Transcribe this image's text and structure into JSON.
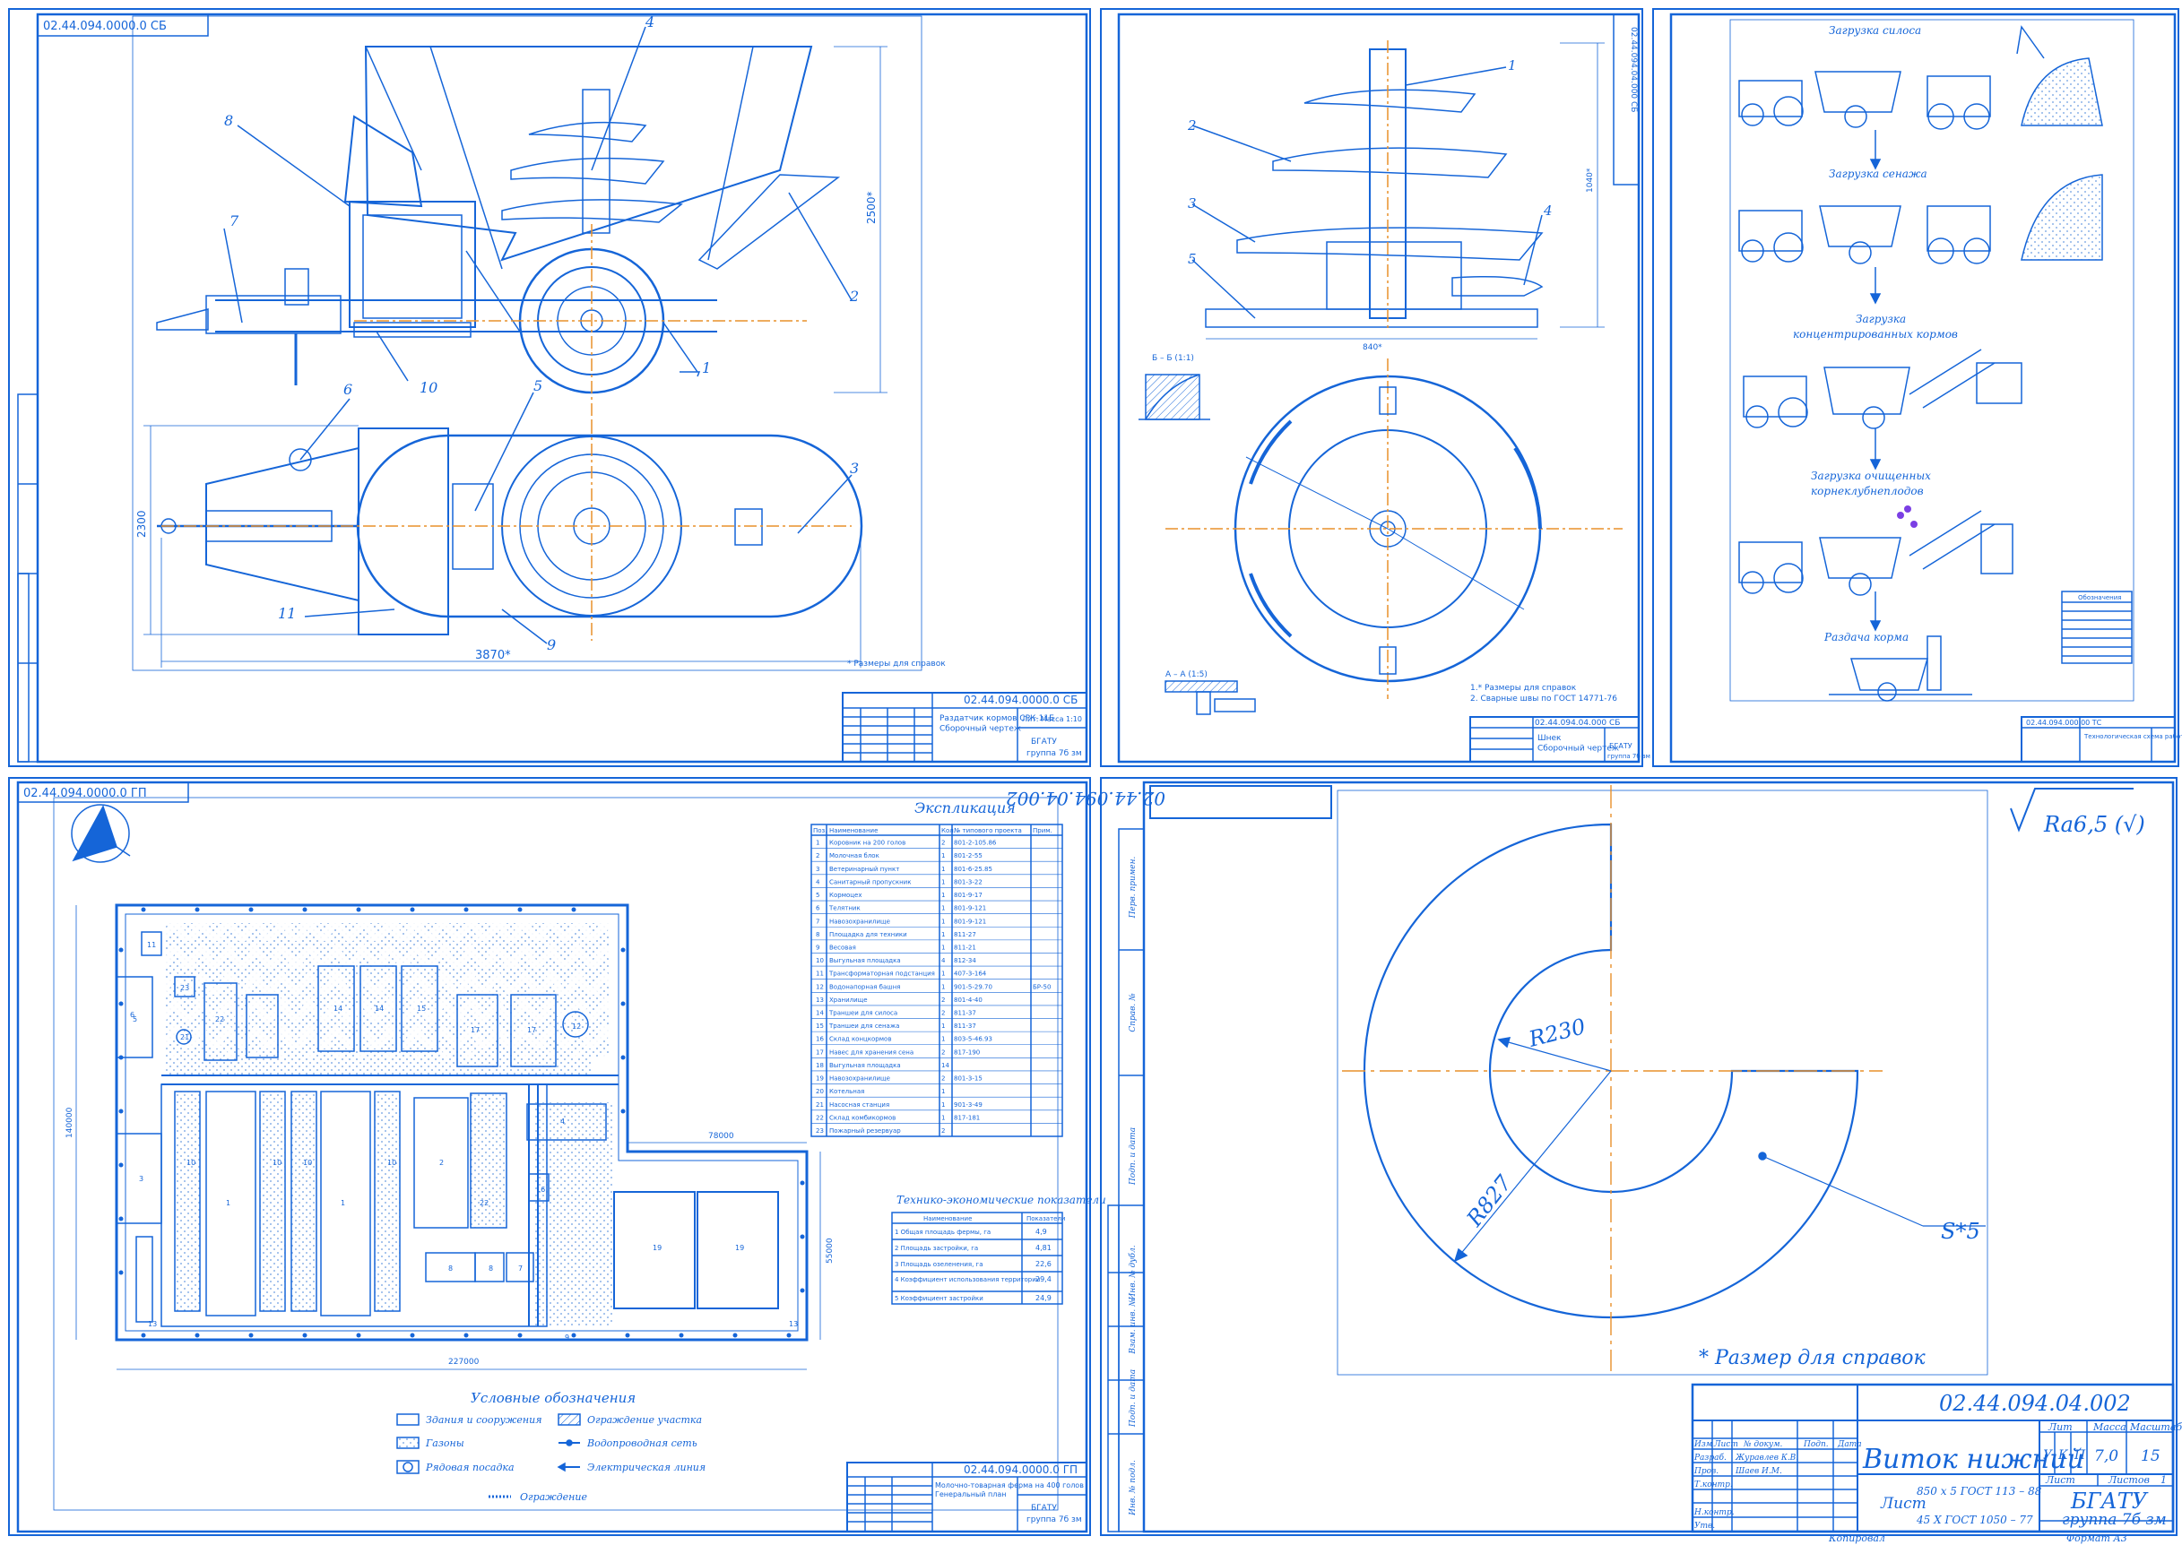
{
  "sheets": {
    "combine": {
      "code_stamp": "02.44.094.0000.0 СБ",
      "code_rot": "02.44.094.0000.0 СБ",
      "title": "Раздатчик кормов СРК-11Б\nСборочный чертеж",
      "sheet_info": "Лит. Масса 1:10",
      "org": "БГАТУ",
      "group": "группа 7б зм",
      "dim_height": "2500*",
      "dim_width": "2300",
      "dim_length": "3870*",
      "note": "* Размеры для справок",
      "callouts": [
        "1",
        "2",
        "3",
        "4",
        "5",
        "6",
        "7",
        "8",
        "9",
        "10",
        "11"
      ]
    },
    "auger": {
      "code_rot": "02.44.094.04.000 СБ",
      "code_stamp": "02.44.094.04.000 СБ",
      "title": "Шнек\nСборочный чертеж",
      "org": "БГАТУ",
      "group": "группа 7б зм",
      "section_label": "Б – Б (1:1)",
      "view_label": "А – А (1:5)",
      "dim_side": "840*",
      "dim_height": "1040*",
      "note1": "1.* Размеры для справок",
      "note2": "2. Сварные швы по ГОСТ 14771-76",
      "callouts": [
        "1",
        "2",
        "3",
        "4",
        "5"
      ]
    },
    "tech": {
      "code_stamp": "02.44.094.000.00 ТС",
      "title": "Технологическая схема работы",
      "step1": "Загрузка силоса",
      "step2": "Загрузка сенажа",
      "step3": "Загрузка",
      "step3b": "концентрированных кормов",
      "step4": "Загрузка очищенных",
      "step4b": "корнеклубнеплодов",
      "step5": "Раздача корма",
      "legend_title": "Обозначения"
    },
    "plan": {
      "code_rot": "02.44.094.0000.0 ГП",
      "code_stamp": "02.44.094.0000.0 ГП",
      "title": "Молочно-товарная ферма на 400 голов\nГенеральный план",
      "org": "БГАТУ",
      "group": "группа 7б зм",
      "explication_title": "Экспликация",
      "explication_headers": [
        "Поз.",
        "Наименование",
        "Кол.",
        "№ типового проекта",
        "Прим."
      ],
      "explication_rows": [
        [
          "1",
          "Коровник на 200 голов",
          "2",
          "801-2-105.86",
          ""
        ],
        [
          "2",
          "Молочная блок",
          "1",
          "801-2-55",
          ""
        ],
        [
          "3",
          "Ветеринарный пункт",
          "1",
          "801-6-25.85",
          ""
        ],
        [
          "4",
          "Санитарный пропускник",
          "1",
          "801-3-22",
          ""
        ],
        [
          "5",
          "Кормоцех",
          "1",
          "801-9-17",
          ""
        ],
        [
          "6",
          "Телятник",
          "1",
          "801-9-121",
          ""
        ],
        [
          "7",
          "Навозохранилище",
          "1",
          "801-9-121",
          ""
        ],
        [
          "8",
          "Площадка для техники",
          "1",
          "811-27",
          ""
        ],
        [
          "9",
          "Весовая",
          "1",
          "811-21",
          ""
        ],
        [
          "10",
          "Выгульная площадка",
          "4",
          "812-34",
          ""
        ],
        [
          "11",
          "Трансформаторная подстанция",
          "1",
          "407-3-164",
          ""
        ],
        [
          "12",
          "Водонапорная башня",
          "1",
          "901-5-29.70",
          "БР-50"
        ],
        [
          "13",
          "Хранилище",
          "2",
          "801-4-40",
          ""
        ],
        [
          "14",
          "Траншеи для силоса",
          "2",
          "811-37",
          ""
        ],
        [
          "15",
          "Траншеи для сенажа",
          "1",
          "811-37",
          ""
        ],
        [
          "16",
          "Склад концкормов",
          "1",
          "803-5-46.93",
          ""
        ],
        [
          "17",
          "Навес для хранения сена",
          "2",
          "817-190",
          ""
        ],
        [
          "18",
          "Выгульная площадка",
          "14",
          "",
          ""
        ],
        [
          "19",
          "Навозохранилище",
          "2",
          "801-3-15",
          ""
        ],
        [
          "20",
          "Котельная",
          "1",
          "",
          ""
        ],
        [
          "21",
          "Насосная станция",
          "1",
          "901-3-49",
          ""
        ],
        [
          "22",
          "Склад комбикормов",
          "1",
          "817-181",
          ""
        ],
        [
          "23",
          "Пожарный резервуар",
          "2",
          "",
          ""
        ]
      ],
      "tep_title": "Технико-экономические показатели",
      "tep_headers": [
        "Наименование",
        "Показатели"
      ],
      "tep_rows": [
        [
          "1 Общая площадь фермы, га",
          "4,9"
        ],
        [
          "2 Площадь застройки, га",
          "4,81"
        ],
        [
          "3 Площадь озеленения, га",
          "22,6"
        ],
        [
          "4 Коэффициент использования территории",
          "29,4"
        ],
        [
          "5 Коэффициент застройки",
          "24,9"
        ]
      ],
      "legend_title": "Условные обозначения",
      "legend": [
        "Здания и сооружения",
        "Газоны",
        "Рядовая посадка",
        "Ограждение участка",
        "Водопроводная сеть",
        "Электрическая линия",
        "Ограждение"
      ],
      "dim_height": "140000",
      "dim_width": "227000",
      "dim_small": "78000",
      "dim_small2": "55000",
      "building_labels": [
        "11",
        "23",
        "21",
        "6",
        "22",
        "14",
        "14",
        "15",
        "17",
        "17",
        "12",
        "4",
        "3",
        "1",
        "1",
        "10",
        "10",
        "10",
        "10",
        "2",
        "22",
        "8",
        "8",
        "7",
        "19",
        "19",
        "13",
        "13",
        "9",
        "5",
        "16"
      ]
    },
    "coil": {
      "code_rot": "02.44.094.04.002",
      "code_stamp": "02.44.094.04.002",
      "title": "Виток нижний",
      "roughness": "Ra6,5 (√)",
      "radius_inner": "R230",
      "radius_outer": "R827",
      "thickness": "S*5",
      "note": "* Размер для справок",
      "material_line1": "Лист",
      "material_line2": "850 х 5 ГОСТ 113 – 88",
      "material_line3": "45 Х ГОСТ 1050 – 77",
      "lit": [
        "У",
        "К",
        "П"
      ],
      "mass": "7,0",
      "scale": "15",
      "mass_label": "Масса",
      "scale_label": "Масштаб",
      "lit_label": "Лит",
      "sheet_label": "Лист",
      "sheets_label": "Листов",
      "sheets": "1",
      "org": "БГАТУ",
      "group": "группа 7б зм",
      "format": "Формат А3",
      "copied": "Копировал",
      "headers": [
        "Изм",
        "Лист",
        "№ докум.",
        "Подп.",
        "Дата"
      ],
      "roles": [
        "Разраб.",
        "Пров.",
        "Т.контр.",
        "",
        "Н.контр.",
        "Утв."
      ],
      "names": [
        "Журавлев К.В.",
        "Шаев И.М.",
        "",
        "",
        "",
        ""
      ],
      "side_labels": [
        "Перв. примен.",
        "Справ. №",
        "Подп. и дата",
        "Инв. № дубл.",
        "Взам. инв. №",
        "Подп. и дата",
        "Инв. № подл."
      ]
    }
  },
  "colors": {
    "line": "#1565d8",
    "axis": "#e8902a",
    "hatch": "#5b8fd8"
  }
}
